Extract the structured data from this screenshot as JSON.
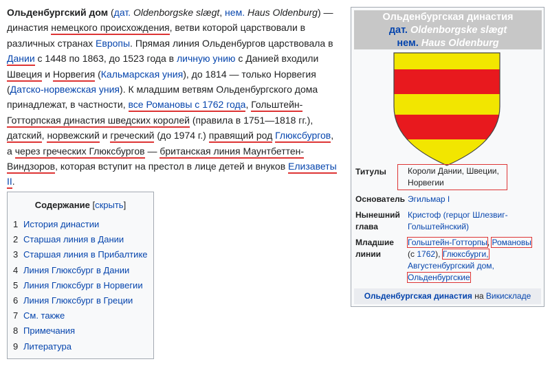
{
  "article": {
    "s1_title": "Ольденбургский дом",
    "s2": " (",
    "s3_link_dat": "дат.",
    "s4_dat_name": " Oldenborgske slægt",
    "s5": ", ",
    "s6_link_nem": "нем.",
    "s7_nem_name": " Haus Oldenburg",
    "s8": ") — династия ",
    "s9_link_origin": "немецкого происхождения",
    "s10": ", ветви которой царствовали в различных странах ",
    "s11_link_europe": "Европы",
    "s12": ". Прямая линия Ольденбургов царствовала в ",
    "s13_link_denmark": "Дании",
    "s14": " с 1448 по 1863, до 1523 года в ",
    "s15_link_union": "личную унию",
    "s16": " с Данией входили ",
    "s17_link_sweden": "Швеция",
    "s18": " и ",
    "s19_link_norway": "Норвегия",
    "s20": " (",
    "s21_link_kalmar": "Кальмарская уния",
    "s22": "), до 1814 — только Норвегия (",
    "s23_link_dn_union": "Датско-норвежская уния",
    "s24": "). К младшим ветвям Ольденбургского дома принадлежат, в частности, ",
    "s25_link_romanovs": "все Романовы с 1762 года",
    "s26": ", ",
    "s27_link_hg": "Гольштейн-Готторпская династия шведских королей",
    "s28": " (правила в 1751—1818 гг.), ",
    "s29_link_dk": "датский",
    "s30": ", ",
    "s31_link_no": "норвежский",
    "s32": " и ",
    "s33_link_gr": "греческий",
    "s34": " (до 1974 г.) ",
    "s35_link_ruling": "правящий род",
    "s36": " ",
    "s37_link_glucks": "Глюксбургов",
    "s38": ", а ",
    "s39_link_thru": "через греческих Глюксбургов",
    "s40": " — ",
    "s41_link_brit": "британская линия Маунтбеттен-Виндзоров",
    "s42": ", которая вступит на престол в лице детей и внуков ",
    "s43_link_eliz": "Елизаветы II",
    "s44": "."
  },
  "toc": {
    "title": "Содержание",
    "hide_open": " [",
    "hide_label": "скрыть",
    "hide_close": "]",
    "items": [
      {
        "num": "1",
        "label": "История династии"
      },
      {
        "num": "2",
        "label": "Старшая линия в Дании"
      },
      {
        "num": "3",
        "label": "Старшая линия в Прибалтике"
      },
      {
        "num": "4",
        "label": "Линия Глюксбург в Дании"
      },
      {
        "num": "5",
        "label": "Линия Глюксбург в Норвегии"
      },
      {
        "num": "6",
        "label": "Линия Глюксбург в Греции"
      },
      {
        "num": "7",
        "label": "См. также"
      },
      {
        "num": "8",
        "label": "Примечания"
      },
      {
        "num": "9",
        "label": "Литература"
      }
    ]
  },
  "infobox": {
    "title": "Ольденбургская династия",
    "sub1_link": "дат.",
    "sub1_name": " Oldenborgske slægt",
    "sub2_link": "нем.",
    "sub2_name": " Haus Oldenburg",
    "colors": {
      "crest_gold": "#f2e600",
      "crest_red": "#e8191e",
      "annot": "#dd3333"
    },
    "rows": {
      "titles_label": "Титулы",
      "titles_value": "Короли Дании, Швеции, Норвегии",
      "founder_label": "Основатель",
      "founder_value": "Эгильмар I",
      "current_label": "Нынешний глава",
      "current_value": "Кристоф (герцог Шлезвиг-Гольштейнский)",
      "cadet_label": "Младшие линии",
      "cadet_1": "Гольштейн-Готторпы",
      "cadet_sep1": ", ",
      "cadet_2": "Романовы",
      "cadet_3": " (с ",
      "cadet_4": "1762",
      "cadet_5": "), ",
      "cadet_6": "Глюксбурги,",
      "cadet_7": "Августенбургский дом,",
      "cadet_8": "Ольденбургские"
    },
    "footer_link": "Ольденбургская династия",
    "footer_mid": " на ",
    "footer_link2": "Викискладе"
  }
}
